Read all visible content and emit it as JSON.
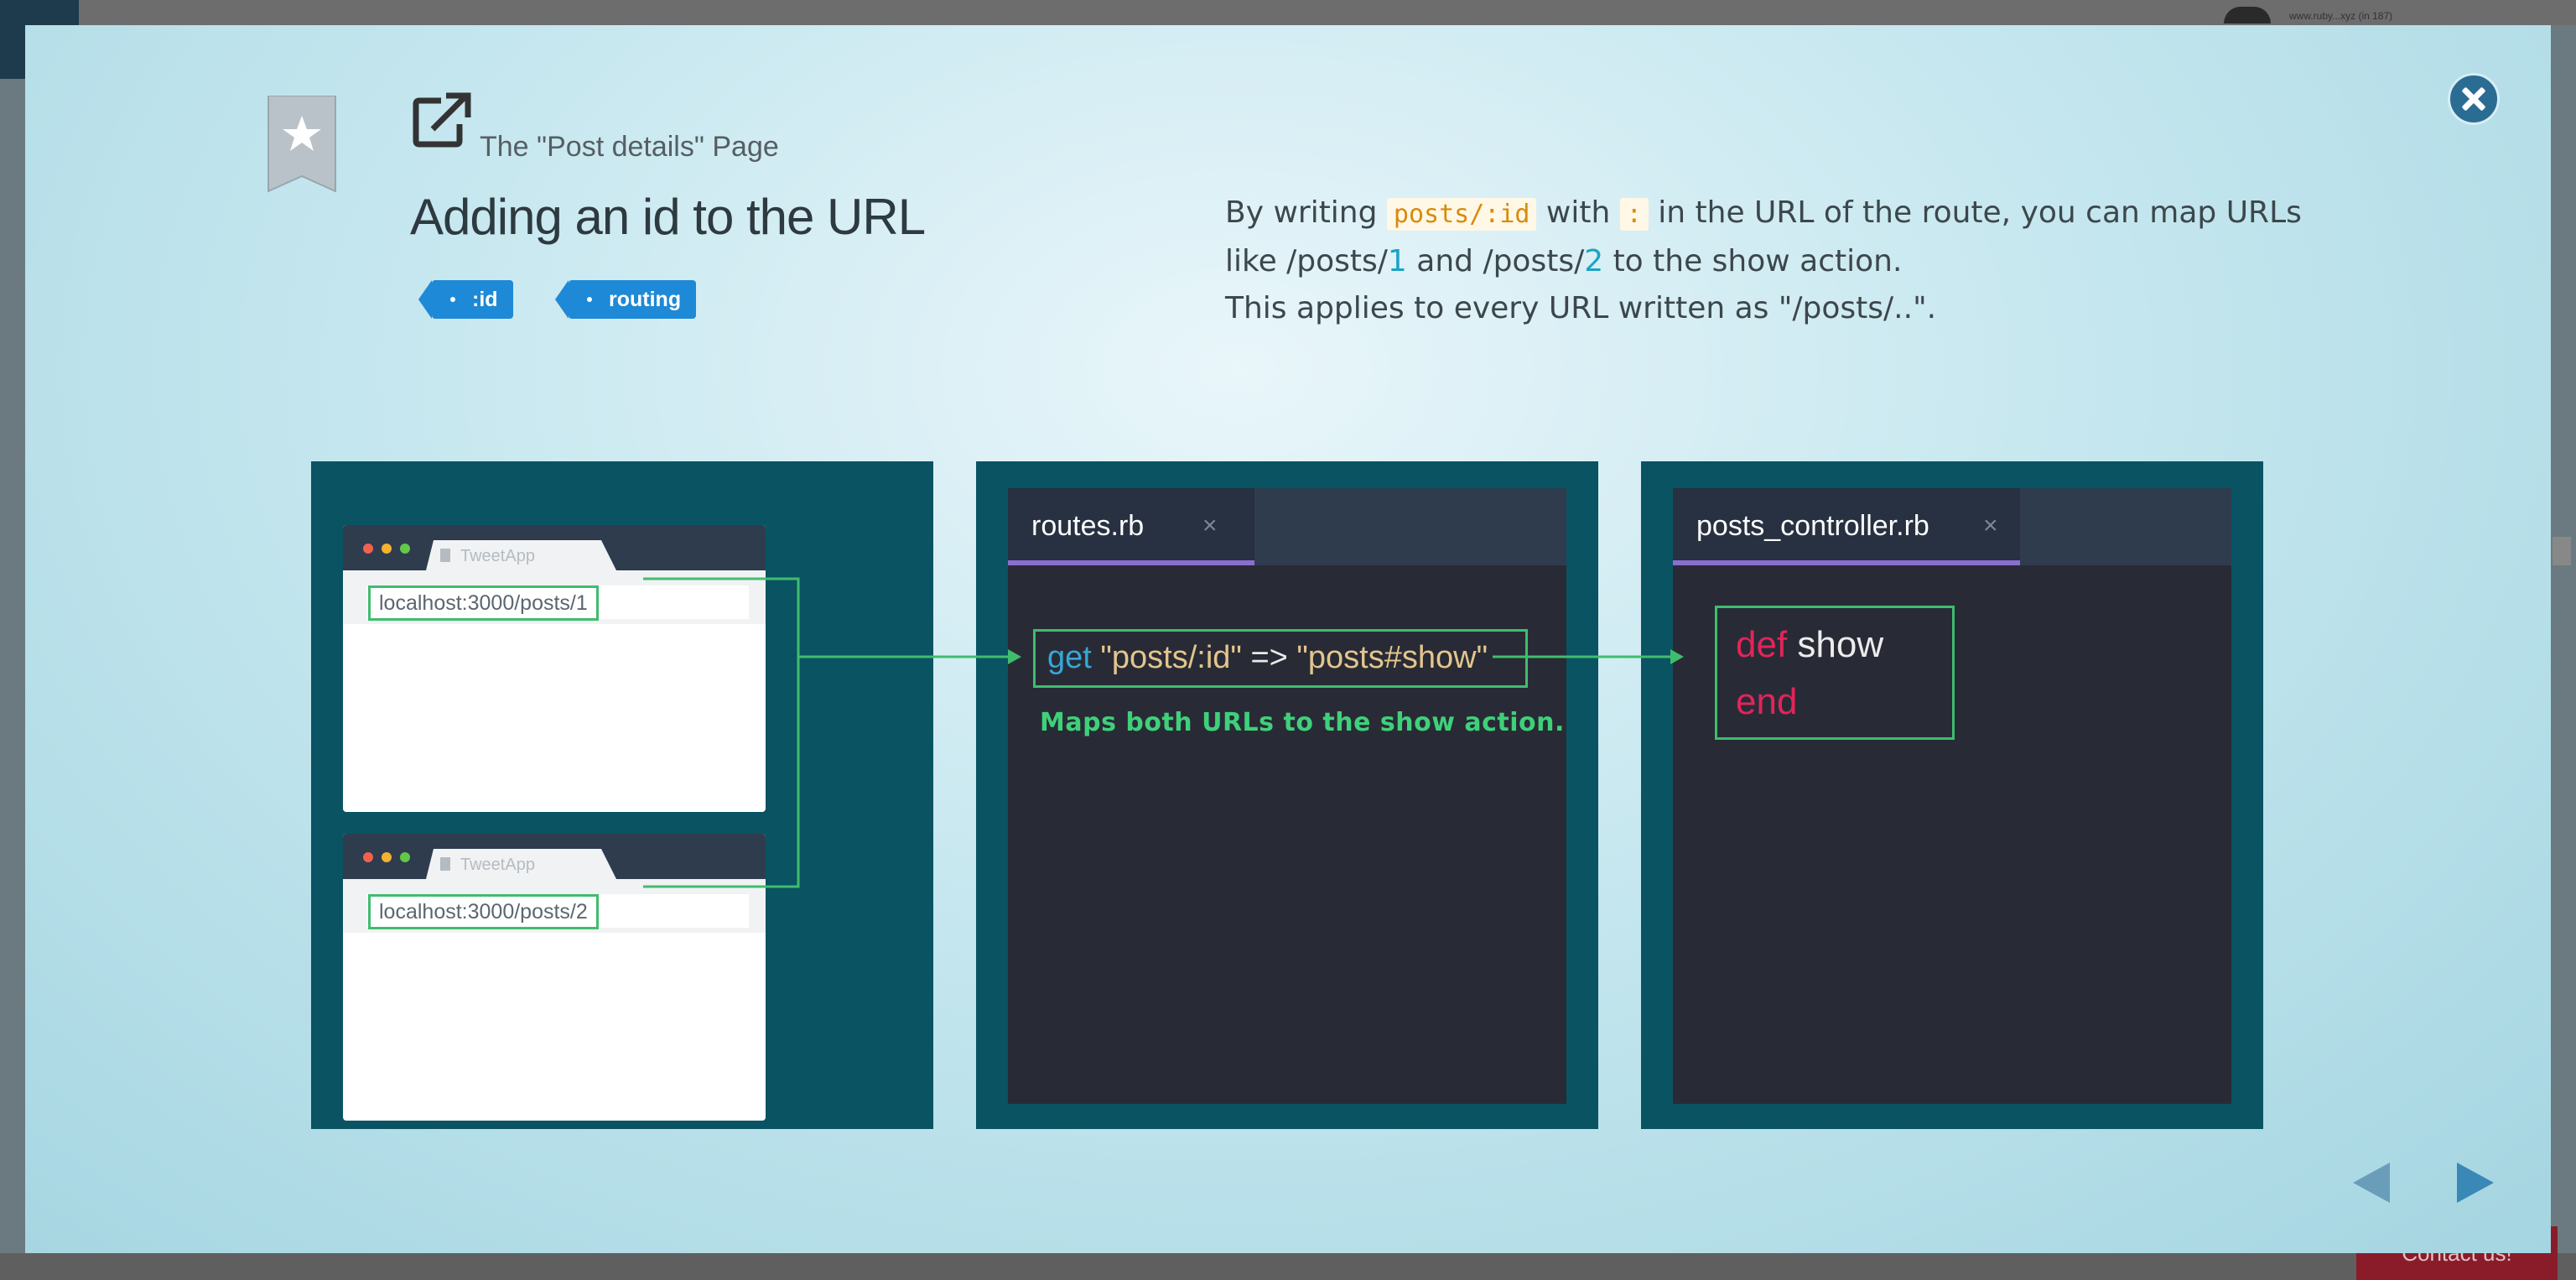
{
  "background": {
    "url_snippet": "www.ruby...xyz (in 187)",
    "contact_label": "Contact us!"
  },
  "header": {
    "breadcrumb": "The \"Post details\" Page",
    "title": "Adding an id to the URL",
    "tags": [
      ":id",
      "routing"
    ]
  },
  "description": {
    "line1_pre": "By writing ",
    "line1_code1": "posts/:id",
    "line1_mid": " with ",
    "line1_code2": ":",
    "line1_post": " in the URL of the route, you can map URLs",
    "line2_a": "like /posts/",
    "line2_n1": "1",
    "line2_b": " and /posts/",
    "line2_n2": "2",
    "line2_c": " to the show action.",
    "line3": "This applies to every URL written as \"/posts/..\"."
  },
  "panel_browsers": {
    "tab_label": "TweetApp",
    "urls": [
      "localhost:3000/posts/1",
      "localhost:3000/posts/2"
    ]
  },
  "panel_routes": {
    "filename": "routes.rb",
    "close_glyph": "×",
    "code_get": "get",
    "code_path": "\"posts/:id\"",
    "code_arrow": "=>",
    "code_action": "\"posts#show\"",
    "annotation": "Maps both URLs to the show action."
  },
  "panel_controller": {
    "filename": "posts_controller.rb",
    "close_glyph": "×",
    "kw_def": "def",
    "method": "show",
    "kw_end": "end"
  },
  "colors": {
    "panel_bg": "#0a5362",
    "highlight_green": "#3fbd6f",
    "tag_blue": "#1e89d6",
    "keyword_red": "#e2245a"
  }
}
